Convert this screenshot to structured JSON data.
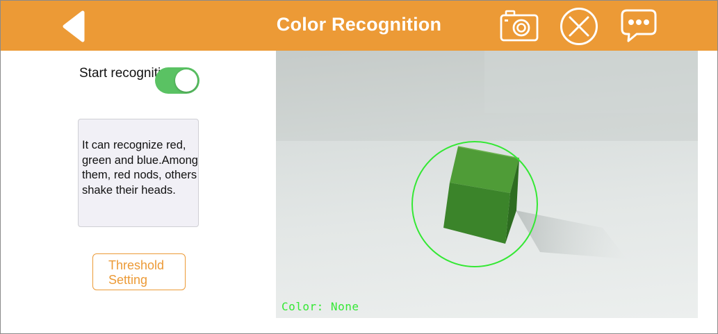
{
  "header": {
    "title": "Color Recognition",
    "background_color": "#ec9a36",
    "back_icon": "back-arrow-icon",
    "camera_icon": "camera-icon",
    "close_icon": "close-circle-icon",
    "chat_icon": "chat-bubble-icon"
  },
  "controls": {
    "toggle_label": "Start recognition",
    "toggle_on": true,
    "toggle_color": "#5ac263",
    "info_text": "It can recognize red, green and blue.Among them, red nods, others shake their heads.",
    "threshold_button": "Threshold Setting"
  },
  "camera": {
    "readout": "Color: None",
    "detection_color": "#34e834",
    "object_color": "#3e8f2b"
  }
}
